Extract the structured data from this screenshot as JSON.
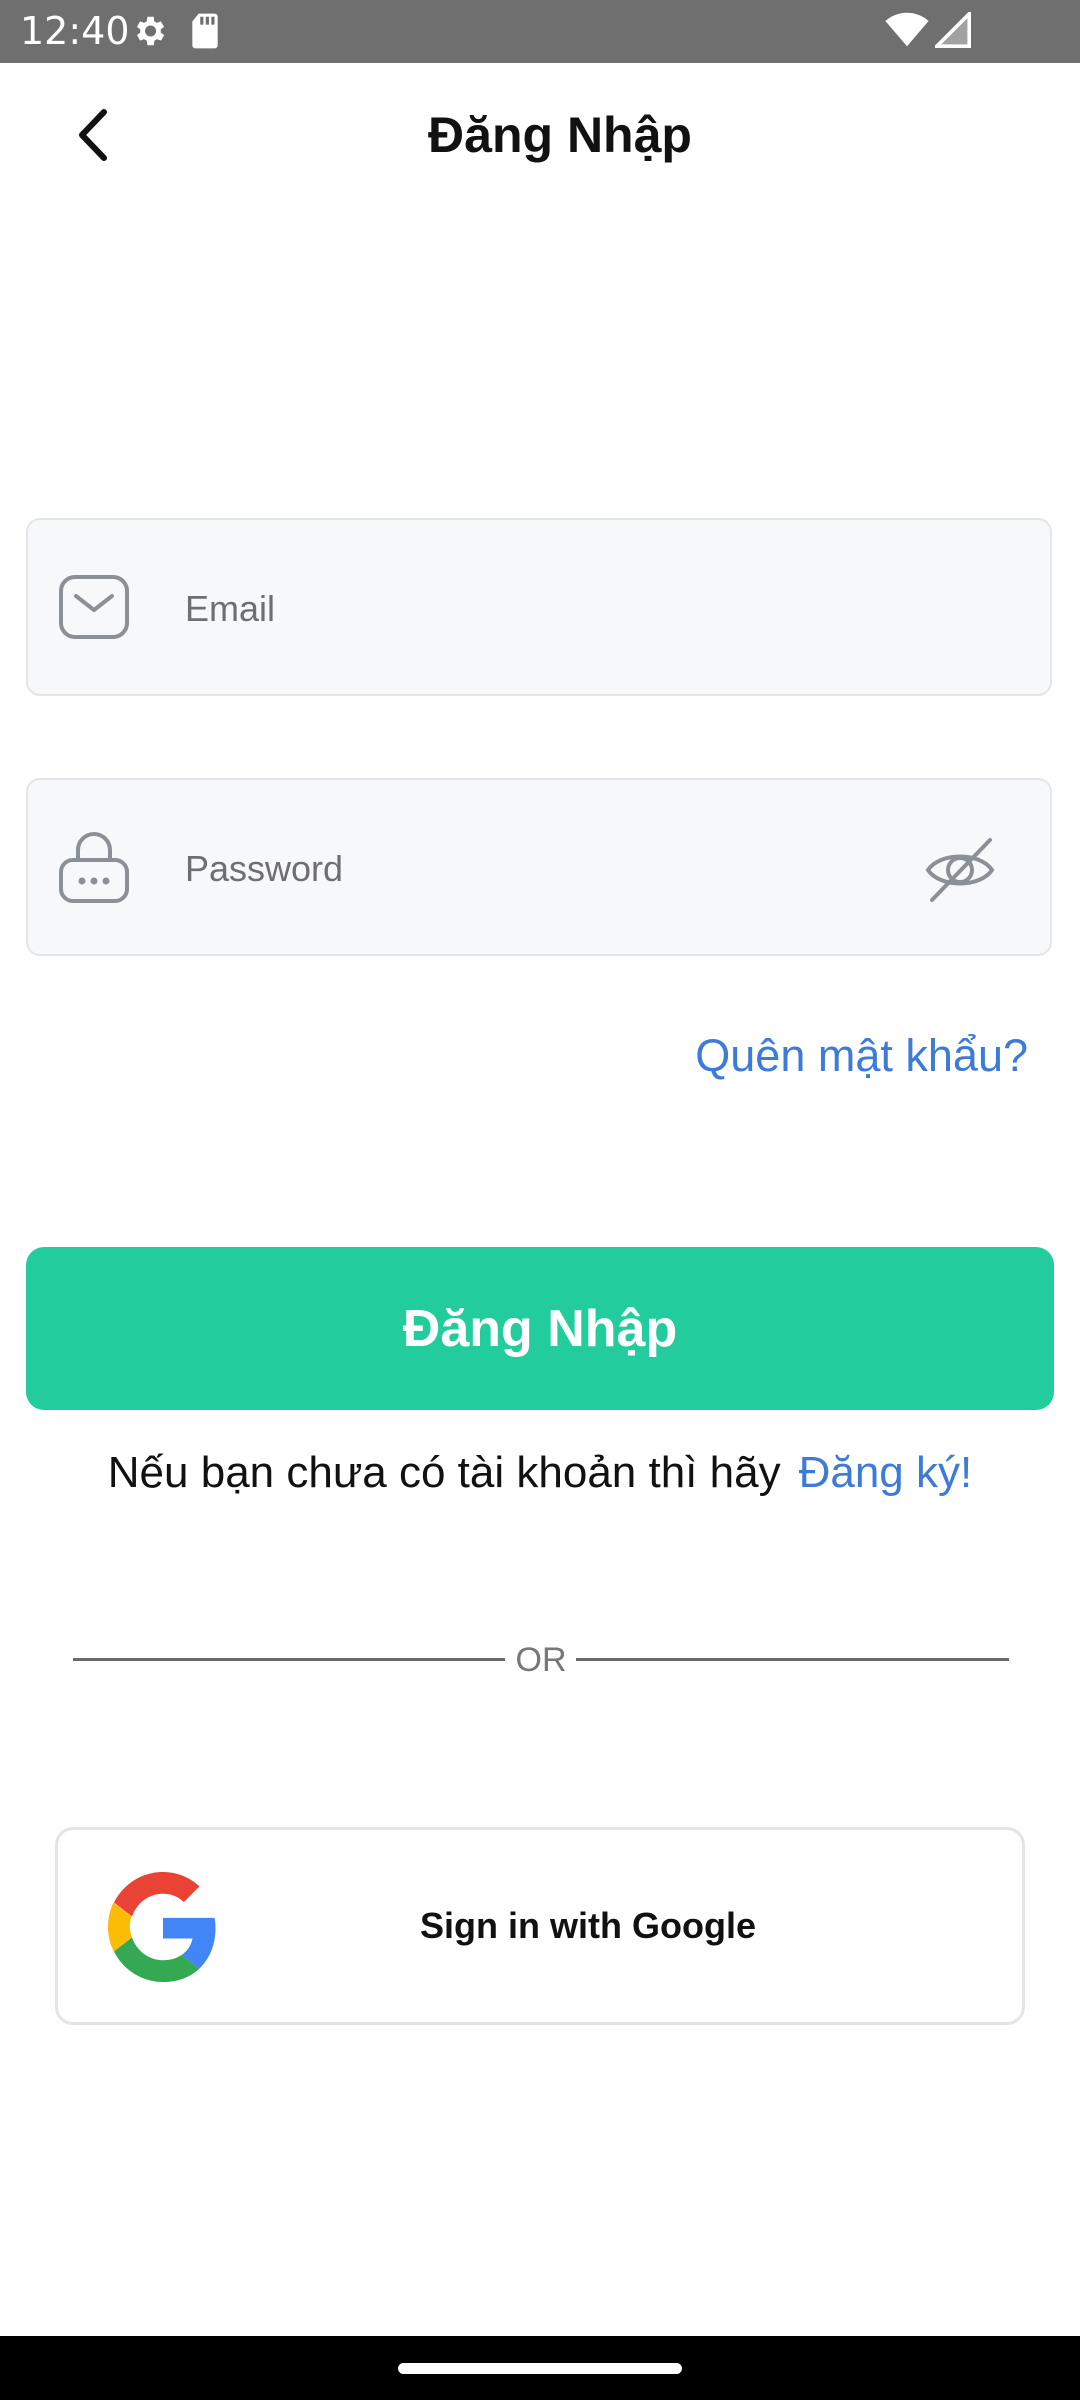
{
  "status_bar": {
    "time": "12:40",
    "icons": [
      "settings-icon",
      "sd-card-icon",
      "wifi-icon",
      "signal-icon"
    ]
  },
  "header": {
    "title": "Đăng Nhập",
    "back_icon": "chevron-left-icon"
  },
  "email_field": {
    "placeholder": "Email",
    "value": "",
    "icon": "mail-icon"
  },
  "password_field": {
    "placeholder": "Password",
    "value": "",
    "icon": "lock-icon",
    "toggle_icon": "eye-off-icon"
  },
  "forgot_password": "Quên mật khẩu?",
  "login_button": "Đăng Nhập",
  "signup": {
    "prompt": "Nếu bạn chưa có tài khoản thì hãy",
    "link": "Đăng ký!"
  },
  "divider_text": "OR",
  "google_button": {
    "label": "Sign in with Google",
    "icon": "google-icon"
  },
  "colors": {
    "accent_green": "#22cc9c",
    "link_blue": "#3d7bd9",
    "status_bar": "#6f6f6f"
  }
}
